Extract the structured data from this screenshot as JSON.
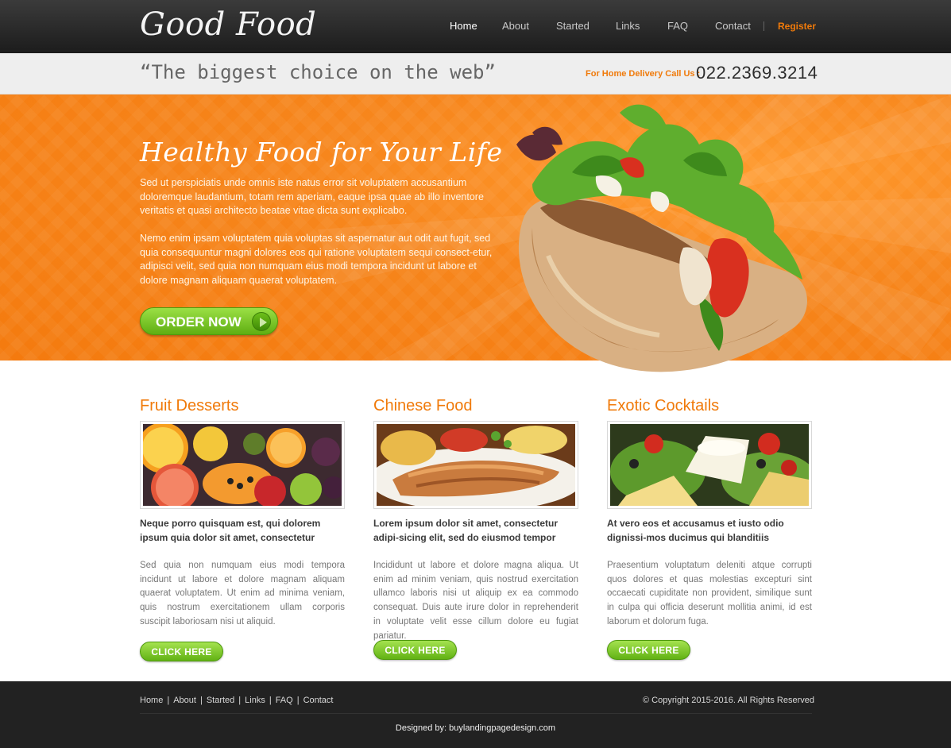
{
  "header": {
    "logo": "Good Food",
    "nav": [
      {
        "label": "Home"
      },
      {
        "label": "About"
      },
      {
        "label": "Started"
      },
      {
        "label": "Links"
      },
      {
        "label": "FAQ"
      },
      {
        "label": "Contact"
      }
    ],
    "register": "Register"
  },
  "tagbar": {
    "tagline": "“The biggest choice on the web”",
    "delivery_label": "For Home Delivery Call Us :",
    "phone": "022.2369.3214"
  },
  "hero": {
    "title": "Healthy Food for Your Life",
    "paragraph1": "Sed ut perspiciatis unde omnis iste natus error sit voluptatem accusantium doloremque laudantium, totam rem aperiam, eaque ipsa quae ab illo inventore veritatis et quasi architecto beatae vitae dicta sunt explicabo.",
    "paragraph2": "Nemo enim ipsam voluptatem quia voluptas sit aspernatur aut odit aut fugit, sed quia consequuntur magni dolores eos qui ratione voluptatem sequi consect-etur, adipisci velit, sed quia non numquam eius modi tempora incidunt ut labore et dolore magnam aliquam quaerat voluptatem.",
    "order_button": "ORDER NOW"
  },
  "columns": [
    {
      "title": "Fruit Desserts",
      "heading": "Neque porro quisquam est, qui dolorem ipsum quia dolor sit amet, consectetur",
      "body": "Sed quia non numquam eius modi tempora incidunt ut labore et dolore magnam aliquam quaerat voluptatem. Ut enim ad minima veniam, quis nostrum exercitationem ullam corporis suscipit laboriosam nisi ut aliquid.",
      "button": "CLICK HERE"
    },
    {
      "title": "Chinese Food",
      "heading": "Lorem ipsum dolor sit amet, consectetur adipi-sicing elit, sed do eiusmod tempor",
      "body": "Incididunt ut labore et dolore magna aliqua. Ut enim ad minim veniam, quis nostrud exercitation ullamco laboris nisi ut aliquip ex ea commodo consequat. Duis aute irure dolor in reprehenderit in voluptate velit esse cillum dolore eu fugiat pariatur.",
      "button": "CLICK HERE"
    },
    {
      "title": "Exotic Cocktails",
      "heading": "At vero eos et accusamus et iusto odio dignissi-mos ducimus qui blanditiis",
      "body": "Praesentium voluptatum deleniti atque corrupti quos dolores et quas molestias excepturi sint occaecati cupiditate non provident, similique sunt in culpa qui officia deserunt mollitia animi, id est laborum et dolorum fuga.",
      "button": "CLICK HERE"
    }
  ],
  "footer": {
    "nav": [
      {
        "label": "Home"
      },
      {
        "label": "About"
      },
      {
        "label": "Started"
      },
      {
        "label": "Links"
      },
      {
        "label": "FAQ"
      },
      {
        "label": "Contact"
      }
    ],
    "separator": "|",
    "copyright": "© Copyright 2015-2016. All Rights Reserved",
    "designed_by": "Designed by: buylandingpagedesign.com"
  },
  "colors": {
    "accent_orange": "#f07a0a",
    "button_green": "#62b214",
    "header_dark": "#1c1c1c",
    "footer_dark": "#222222"
  }
}
